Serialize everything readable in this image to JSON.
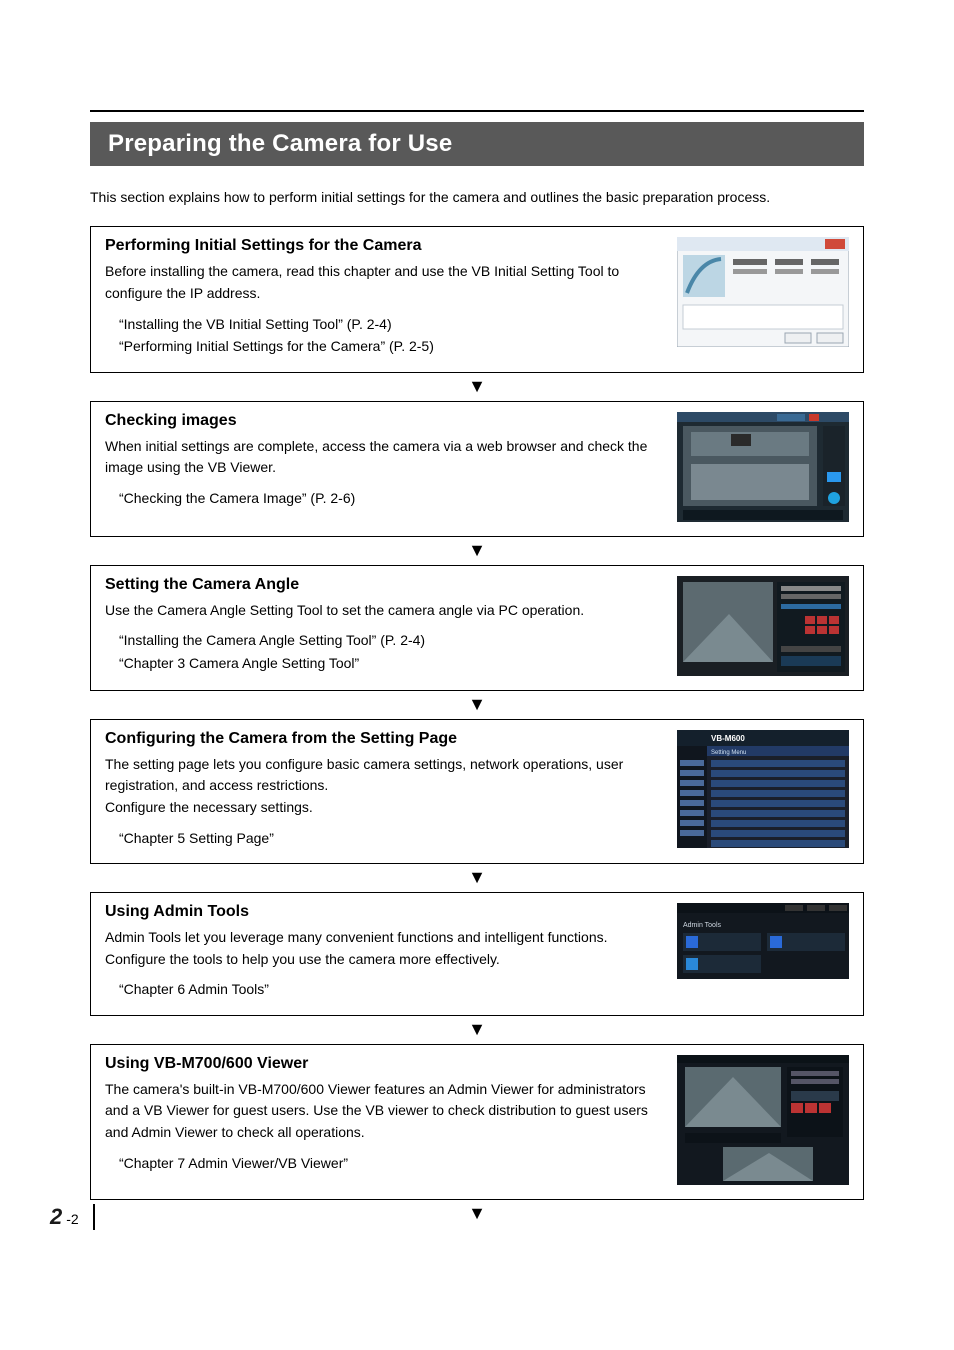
{
  "title": "Preparing the Camera for Use",
  "intro": "This section explains how to perform initial settings for the camera and outlines the basic preparation process.",
  "sections": [
    {
      "title": "Performing Initial Settings for the Camera",
      "desc": "Before installing the camera, read this chapter and use the VB Initial Setting Tool to configure the IP address.",
      "refs": [
        "“Installing the VB Initial Setting Tool” (P. 2-4)",
        "“Performing Initial Settings for the Camera” (P. 2-5)"
      ]
    },
    {
      "title": "Checking images",
      "desc": "When initial settings are complete, access the camera via a web browser and check the image using the VB Viewer.",
      "refs": [
        "“Checking the Camera Image” (P. 2-6)"
      ]
    },
    {
      "title": "Setting the Camera Angle",
      "desc": "Use the Camera Angle Setting Tool to set the camera angle via PC operation.",
      "refs": [
        "“Installing the Camera Angle Setting Tool” (P. 2-4)",
        "“Chapter 3 Camera Angle Setting Tool”"
      ]
    },
    {
      "title": "Configuring the Camera from the Setting Page",
      "desc": "The setting page lets you configure basic camera settings, network operations, user registration, and access restrictions.\nConfigure the necessary settings.",
      "refs": [
        "“Chapter 5 Setting Page”"
      ]
    },
    {
      "title": "Using Admin Tools",
      "desc": "Admin Tools let you leverage many convenient functions and intelligent functions. Configure the tools to help you use the camera more effectively.",
      "refs": [
        "“Chapter 6 Admin Tools”"
      ]
    },
    {
      "title": "Using VB-M700/600 Viewer",
      "desc": "The camera's built-in VB-M700/600 Viewer features an Admin Viewer for administrators and a VB Viewer for guest users. Use the VB viewer to check distribution to guest users and Admin Viewer to check all operations.",
      "refs": [
        "“Chapter 7 Admin Viewer/VB Viewer”"
      ]
    }
  ],
  "pageNumber": {
    "chapter": "2",
    "page": "-2"
  }
}
